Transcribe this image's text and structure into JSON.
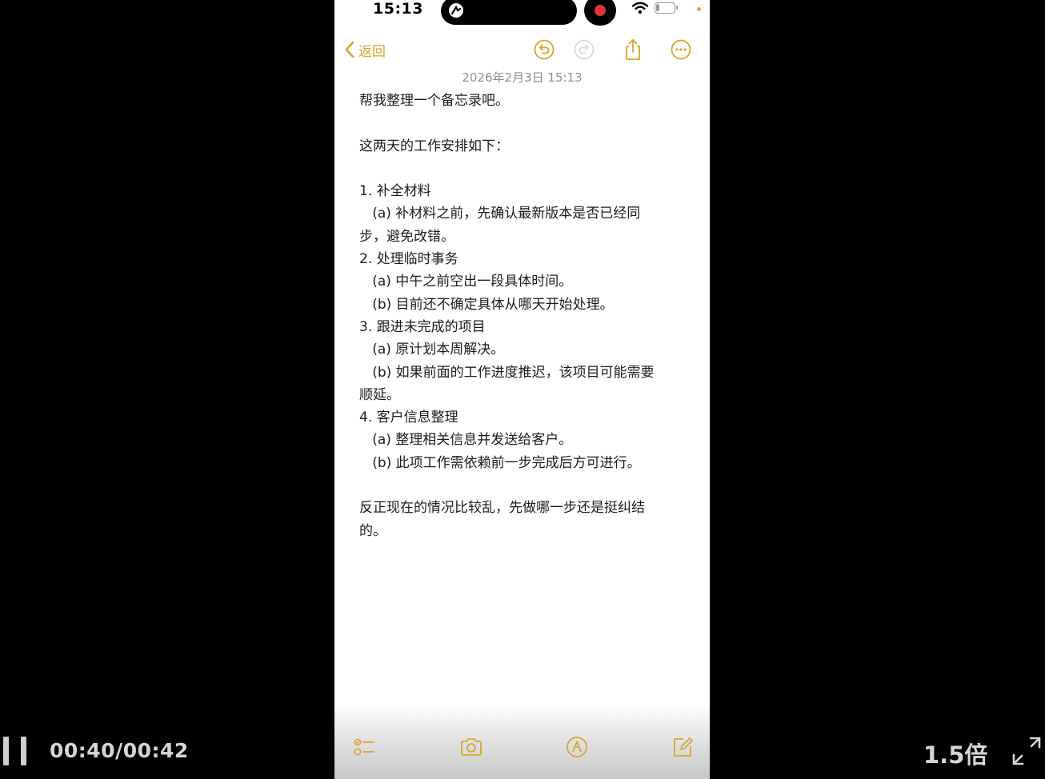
{
  "status_bar": {
    "time": "15:13",
    "battery_level": "21",
    "battery_fraction": 0.21,
    "recording": true
  },
  "nav": {
    "back_label": "返回",
    "icons": [
      "undo-icon",
      "redo-icon",
      "share-icon",
      "more-icon"
    ]
  },
  "note": {
    "date": "2026年2月3日 15:13",
    "lines": [
      "帮我整理一个备忘录吧。",
      "",
      "这两天的工作安排如下：",
      "",
      "1. 补全材料",
      "   (a) 补材料之前，先确认最新版本是否已经同",
      "步，避免改错。",
      "2. 处理临时事务",
      "   (a) 中午之前空出一段具体时间。",
      "   (b) 目前还不确定具体从哪天开始处理。",
      "3. 跟进未完成的项目",
      "   (a) 原计划本周解决。",
      "   (b) 如果前面的工作进度推迟，该项目可能需要",
      "顺延。",
      "4. 客户信息整理",
      "   (a) 整理相关信息并发送给客户。",
      "   (b) 此项工作需依赖前一步完成后方可进行。",
      "",
      "反正现在的情况比较乱，先做哪一步还是挺纠结",
      "的。"
    ]
  },
  "bottom_toolbar": {
    "icons": [
      "checklist-icon",
      "camera-icon",
      "markup-icon",
      "compose-icon"
    ]
  },
  "player": {
    "time": "00:40/00:42",
    "speed": "1.5倍",
    "state": "playing"
  },
  "colors": {
    "accent": "#d9a52b",
    "note_text": "#1c1c1e",
    "date_text": "#8e8e93",
    "player_text": "#d6d6d6",
    "record": "#e0333a"
  }
}
